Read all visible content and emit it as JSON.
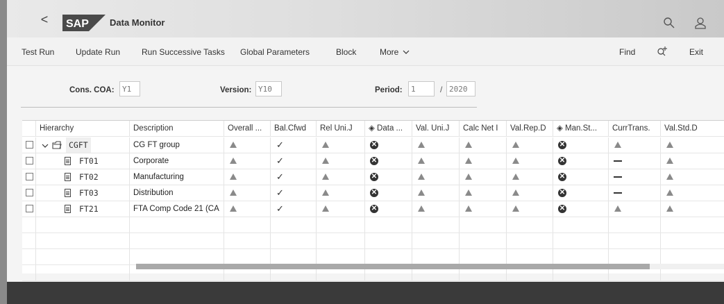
{
  "header": {
    "back_label": "<",
    "logo_text": "SAP",
    "title": "Data Monitor",
    "icons": [
      "search-icon",
      "user-icon"
    ]
  },
  "toolbar": {
    "items": [
      "Test Run",
      "Update Run",
      "Run Successive Tasks",
      "Global Parameters",
      "Block",
      "More"
    ],
    "find_label": "Find",
    "exit_label": "Exit"
  },
  "form": {
    "cons_coa_label": "Cons. COA:",
    "cons_coa_value": "Y1",
    "version_label": "Version:",
    "version_value": "Y10",
    "period_label": "Period:",
    "period_value": "1",
    "period_sep": "/",
    "year_value": "2020"
  },
  "table": {
    "columns": [
      "Hierarchy",
      "Description",
      "Overall ...",
      "Bal.Cfwd",
      "Rel Uni.J",
      "Data ...",
      "Val. Uni.J",
      "Calc Net I",
      "Val.Rep.D",
      "Man.St...",
      "CurrTrans.",
      "Val.Std.D"
    ],
    "rows": [
      {
        "id": "CGFT",
        "desc": "CG FT group",
        "status": [
          "tri",
          "check",
          "tri",
          "x",
          "tri",
          "tri",
          "tri",
          "x",
          "tri",
          "tri"
        ]
      },
      {
        "id": "FT01",
        "desc": "Corporate",
        "status": [
          "tri",
          "check",
          "tri",
          "x",
          "tri",
          "tri",
          "tri",
          "x",
          "dash",
          "tri"
        ]
      },
      {
        "id": "FT02",
        "desc": "Manufacturing",
        "status": [
          "tri",
          "check",
          "tri",
          "x",
          "tri",
          "tri",
          "tri",
          "x",
          "dash",
          "tri"
        ]
      },
      {
        "id": "FT03",
        "desc": "Distribution",
        "status": [
          "tri",
          "check",
          "tri",
          "x",
          "tri",
          "tri",
          "tri",
          "x",
          "dash",
          "tri"
        ]
      },
      {
        "id": "FT21",
        "desc": "FTA Comp Code 21 (CA",
        "status": [
          "tri",
          "check",
          "tri",
          "x",
          "tri",
          "tri",
          "tri",
          "x",
          "tri",
          "tri"
        ]
      }
    ]
  },
  "colors": {
    "shell_bg": "#f4f4f4",
    "footer": "#3a3a3a",
    "status_icon": "#8a8a8a"
  }
}
